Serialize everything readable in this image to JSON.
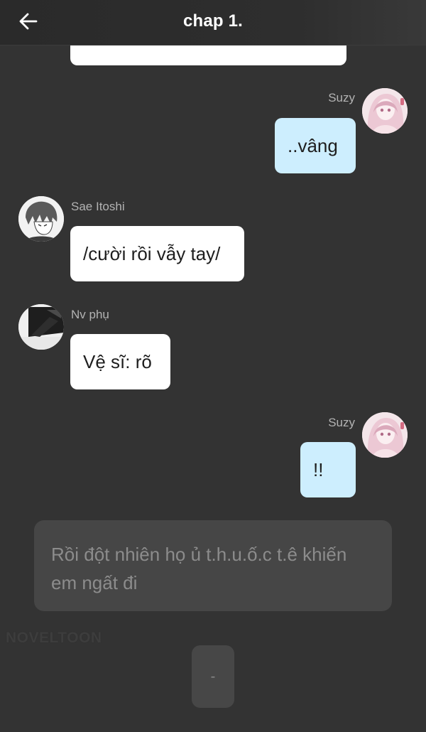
{
  "header": {
    "title": "chap 1."
  },
  "messages": [
    {
      "sender": "Suzy",
      "text": "..vâng",
      "side": "right"
    },
    {
      "sender": "Sae Itoshi",
      "text": "/cười rồi vẫy tay/",
      "side": "left"
    },
    {
      "sender": "Nv phụ",
      "text": "Vệ sĩ: rõ",
      "side": "left"
    },
    {
      "sender": "Suzy",
      "text": "!!",
      "side": "right"
    }
  ],
  "narration": {
    "text": "Rồi đột nhiên họ ủ t.h.u.ố.c t.ê khiến em ngất đi"
  },
  "watermark": {
    "brand": "NOVELTOON"
  },
  "next_button": {
    "label": "-"
  },
  "colors": {
    "background": "#333333",
    "header": "#2a2a2a",
    "bubble_left": "#ffffff",
    "bubble_right": "#cdeefe",
    "narration_box": "#464646"
  },
  "icons": {
    "back": "arrow-left-icon"
  }
}
